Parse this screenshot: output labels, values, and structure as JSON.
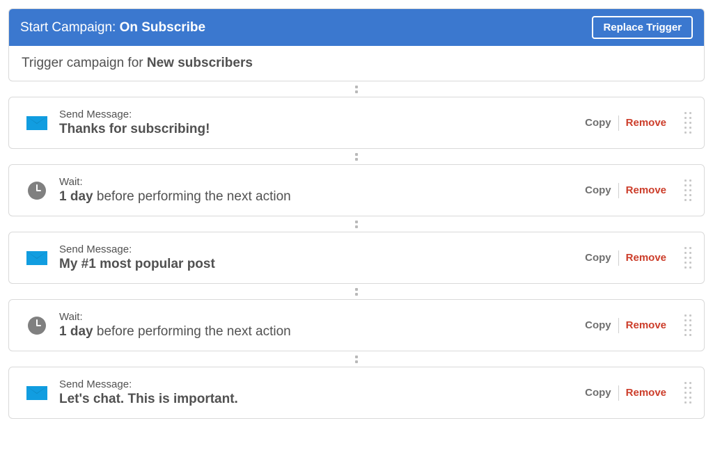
{
  "header": {
    "title_prefix": "Start Campaign: ",
    "title_bold": "On Subscribe",
    "replace_trigger": "Replace Trigger"
  },
  "trigger": {
    "prefix": "Trigger campaign for ",
    "bold": "New subscribers"
  },
  "controls": {
    "copy": "Copy",
    "remove": "Remove"
  },
  "labels": {
    "send_message": "Send Message:",
    "wait": "Wait:"
  },
  "actions": [
    {
      "type": "message",
      "title": "Thanks for subscribing!"
    },
    {
      "type": "wait",
      "bold": "1 day",
      "rest": " before performing the next action"
    },
    {
      "type": "message",
      "title": "My #1 most popular post"
    },
    {
      "type": "wait",
      "bold": "1 day",
      "rest": " before performing the next action"
    },
    {
      "type": "message",
      "title": "Let's chat. This is important."
    }
  ]
}
